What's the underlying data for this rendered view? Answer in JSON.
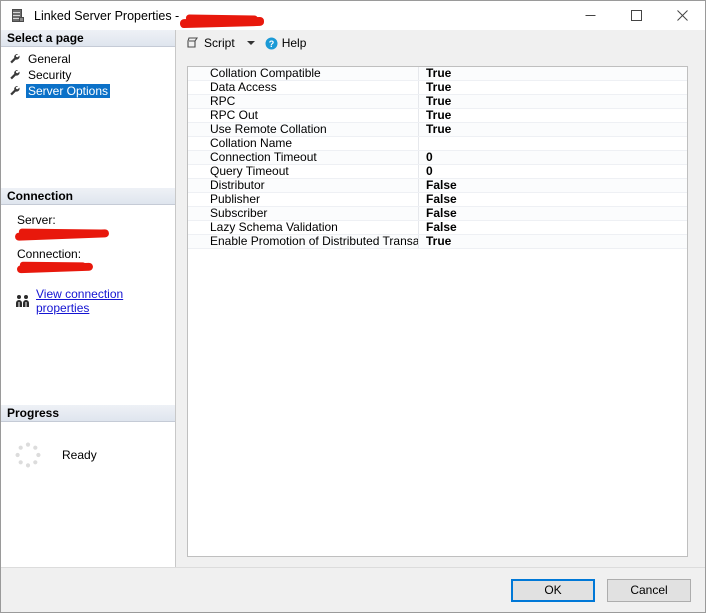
{
  "window": {
    "title_prefix": "Linked Server Properties - ",
    "title_redacted": "",
    "icon": "server-icon",
    "controls": {
      "minimize": "minimize-icon",
      "maximize": "maximize-icon",
      "close": "close-icon"
    }
  },
  "sidebar": {
    "select_page_header": "Select a page",
    "items": [
      {
        "label": "General",
        "icon": "wrench-icon",
        "selected": false
      },
      {
        "label": "Security",
        "icon": "wrench-icon",
        "selected": false
      },
      {
        "label": "Server Options",
        "icon": "wrench-icon",
        "selected": true
      }
    ],
    "connection": {
      "header": "Connection",
      "server_label": "Server:",
      "server_value": "",
      "connection_label": "Connection:",
      "connection_value": "",
      "link_label": "View connection properties",
      "link_icon": "people-icon"
    },
    "progress": {
      "header": "Progress",
      "status": "Ready",
      "icon": "spinner-icon"
    }
  },
  "toolbar": {
    "script_label": "Script",
    "script_icon": "script-icon",
    "dropdown_icon": "chevron-down-icon",
    "help_label": "Help",
    "help_icon": "help-icon"
  },
  "properties": {
    "rows": [
      {
        "name": "Collation Compatible",
        "value": "True"
      },
      {
        "name": "Data Access",
        "value": "True"
      },
      {
        "name": "RPC",
        "value": "True"
      },
      {
        "name": "RPC Out",
        "value": "True"
      },
      {
        "name": "Use Remote Collation",
        "value": "True"
      },
      {
        "name": "Collation Name",
        "value": ""
      },
      {
        "name": "Connection Timeout",
        "value": "0"
      },
      {
        "name": "Query Timeout",
        "value": "0"
      },
      {
        "name": "Distributor",
        "value": "False"
      },
      {
        "name": "Publisher",
        "value": "False"
      },
      {
        "name": "Subscriber",
        "value": "False"
      },
      {
        "name": "Lazy Schema Validation",
        "value": "False"
      },
      {
        "name": "Enable Promotion of Distributed Transaction",
        "value": "True"
      }
    ]
  },
  "footer": {
    "ok_label": "OK",
    "cancel_label": "Cancel"
  },
  "colors": {
    "selection_blue": "#0b71c8",
    "link_blue": "#1414d2",
    "default_button_border": "#0078d7",
    "redaction_red": "#e8180c",
    "help_icon_blue": "#1c9ad6"
  }
}
